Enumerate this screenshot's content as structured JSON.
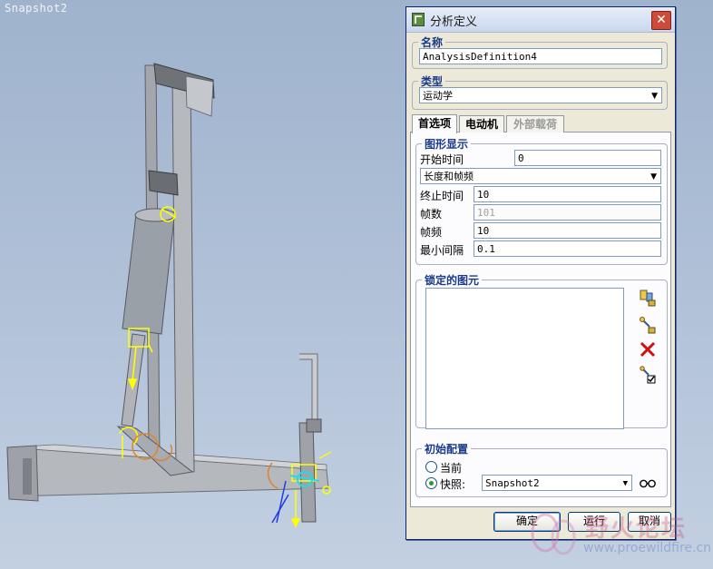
{
  "viewport": {
    "snapshot_label": "Snapshot2"
  },
  "dialog": {
    "title": "分析定义",
    "close_label": "✕",
    "name_section": {
      "legend": "名称",
      "value": "AnalysisDefinition4"
    },
    "type_section": {
      "legend": "类型",
      "selected": "运动学"
    },
    "tabs": [
      {
        "label": "首选项",
        "state": "active"
      },
      {
        "label": "电动机",
        "state": "normal"
      },
      {
        "label": "外部载荷",
        "state": "disabled"
      }
    ],
    "graphics_display": {
      "legend": "图形显示",
      "start_time_label": "开始时间",
      "start_time_value": "0",
      "mode_selected": "长度和帧频",
      "end_time_label": "终止时间",
      "end_time_value": "10",
      "frames_label": "帧数",
      "frames_value": "101",
      "frame_rate_label": "帧频",
      "frame_rate_value": "10",
      "min_interval_label": "最小间隔",
      "min_interval_value": "0.1"
    },
    "locked_entities": {
      "legend": "锁定的图元",
      "icons": [
        "lock-body-icon",
        "lock-connection-icon",
        "delete-icon",
        "enable-check-icon"
      ]
    },
    "initial_config": {
      "legend": "初始配置",
      "current_label": "当前",
      "snapshot_label": "快照:",
      "snapshot_selected": "Snapshot2",
      "current_checked": false,
      "snapshot_checked": true
    },
    "buttons": {
      "ok": "确定",
      "run": "运行",
      "cancel": "取消"
    }
  },
  "watermark": {
    "text": "野火论坛",
    "url": "www.proewildfire.cn"
  },
  "colors": {
    "background": "#aebfd6",
    "model_gray": "#a9adb3",
    "model_dark": "#5d6066",
    "joint_yellow": "#ffff00",
    "joint_orange": "#e0822a",
    "joint_cyan": "#27d9e6",
    "joint_blue": "#1f3ee6",
    "close_red": "#cc4b3a"
  }
}
